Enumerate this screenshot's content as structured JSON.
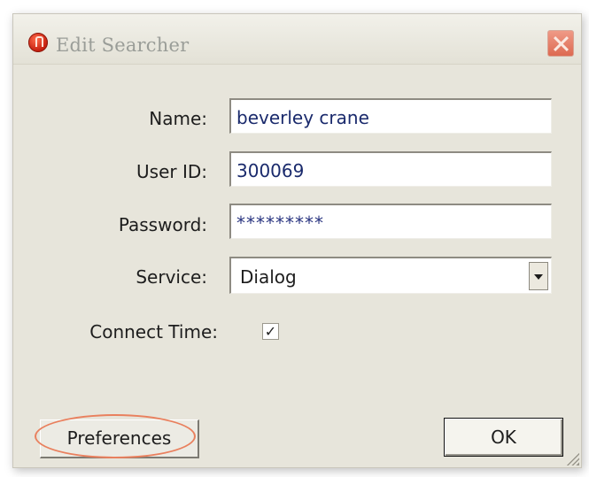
{
  "window": {
    "title": "Edit Searcher",
    "app_icon": "app-logo-icon",
    "close_icon": "close-icon"
  },
  "form": {
    "name_label": "Name:",
    "name_value": "beverley crane",
    "userid_label": "User ID:",
    "userid_value": "300069",
    "password_label": "Password:",
    "password_value": "*********",
    "service_label": "Service:",
    "service_value": "Dialog",
    "connect_time_label": "Connect Time:",
    "connect_time_checked": true,
    "connect_time_mark": "✓"
  },
  "buttons": {
    "preferences_label": "Preferences",
    "ok_label": "OK"
  },
  "colors": {
    "dialog_bg": "#e7e5db",
    "highlight": "#e9805e",
    "close_button": "#dd6a52"
  }
}
